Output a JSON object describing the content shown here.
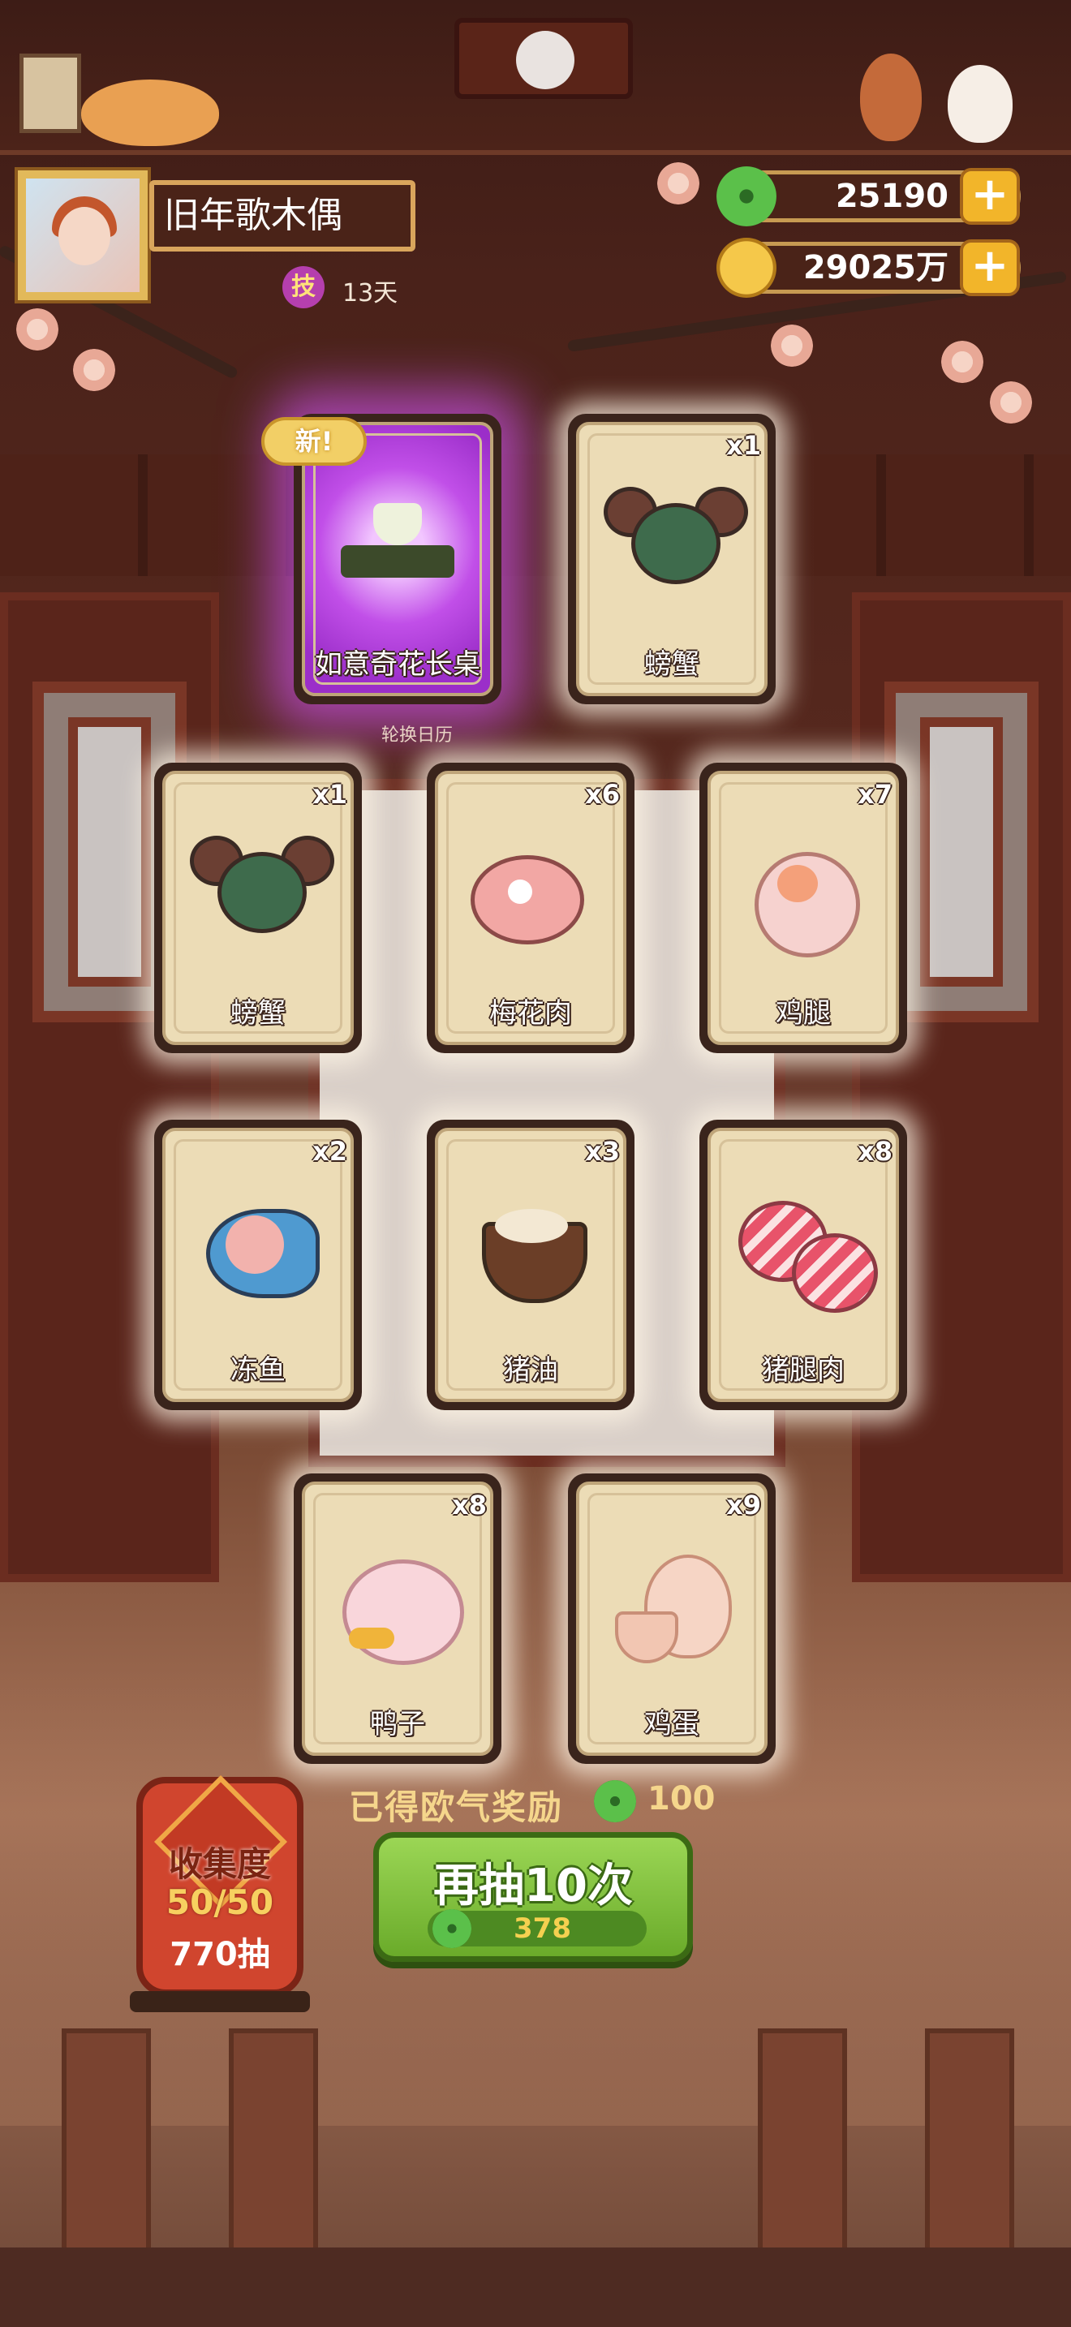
{
  "player": {
    "name": "旧年歌木偶",
    "skill_badge": "技",
    "skill_days": "13天"
  },
  "currencies": [
    {
      "type": "jade",
      "value": "25190",
      "add_icon": "plus-icon"
    },
    {
      "type": "gold",
      "value": "29025万",
      "add_icon": "plus-icon"
    }
  ],
  "labels": {
    "rotate_calendar": "轮换日历",
    "new_badge": "新!"
  },
  "cards": [
    {
      "name": "如意奇花长桌",
      "count": "",
      "is_new": true,
      "art": "table-icon"
    },
    {
      "name": "螃蟹",
      "count": "x1",
      "art": "crab-icon"
    },
    {
      "name": "螃蟹",
      "count": "x1",
      "art": "crab-icon"
    },
    {
      "name": "梅花肉",
      "count": "x6",
      "art": "pork-icon"
    },
    {
      "name": "鸡腿",
      "count": "x7",
      "art": "drumstick-icon"
    },
    {
      "name": "冻鱼",
      "count": "x2",
      "art": "fish-icon"
    },
    {
      "name": "猪油",
      "count": "x3",
      "art": "lard-icon"
    },
    {
      "name": "猪腿肉",
      "count": "x8",
      "art": "pork-leg-icon"
    },
    {
      "name": "鸭子",
      "count": "x8",
      "art": "duck-icon"
    },
    {
      "name": "鸡蛋",
      "count": "x9",
      "art": "egg-icon"
    }
  ],
  "reward": {
    "text": "已得欧气奖励",
    "value": "100"
  },
  "collection": {
    "title": "收集度",
    "progress": "50/50",
    "draws": "770抽"
  },
  "draw_button": {
    "label": "再抽10次",
    "cost": "378"
  },
  "colors": {
    "jade": "#5bc04a",
    "gold": "#f5c84a",
    "button_green": "#7dbe37",
    "special_glow": "#c14fe8"
  }
}
